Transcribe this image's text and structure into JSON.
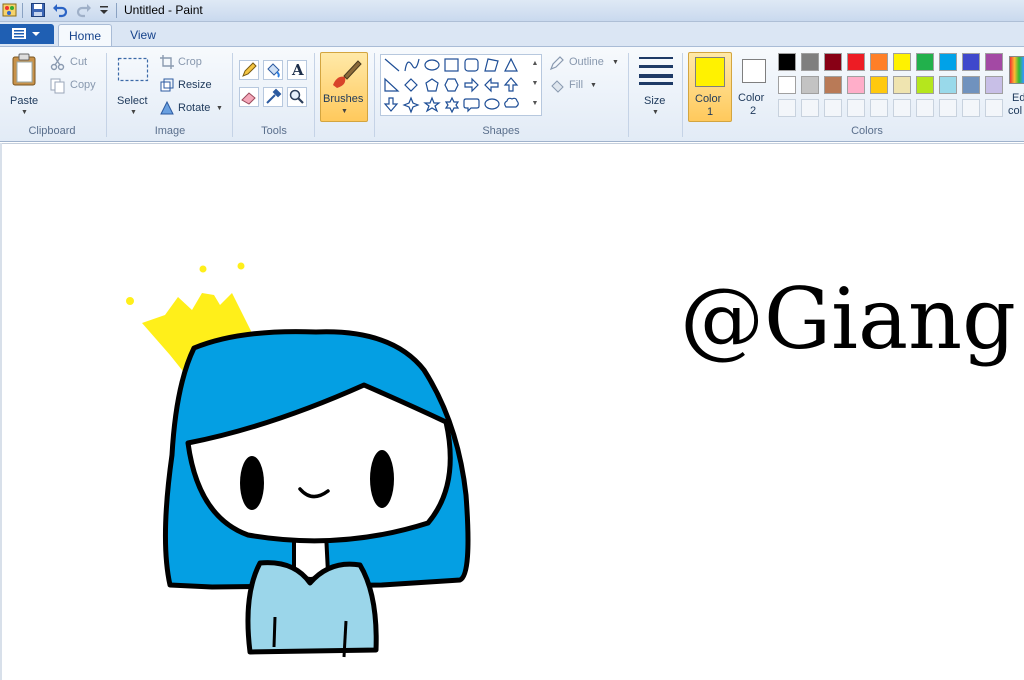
{
  "window": {
    "title": "Untitled - Paint"
  },
  "tabs": {
    "home": "Home",
    "view": "View"
  },
  "clipboard": {
    "paste": "Paste",
    "cut": "Cut",
    "copy": "Copy",
    "group": "Clipboard"
  },
  "image": {
    "select": "Select",
    "crop": "Crop",
    "resize": "Resize",
    "rotate": "Rotate",
    "group": "Image"
  },
  "tools": {
    "group": "Tools",
    "text_glyph": "A"
  },
  "brushes": {
    "label": "Brushes"
  },
  "shapes": {
    "group": "Shapes",
    "outline": "Outline",
    "fill": "Fill"
  },
  "size": {
    "label": "Size"
  },
  "colors": {
    "color1_label": "Color",
    "color1_num": "1",
    "color2_label": "Color",
    "color2_num": "2",
    "edit_label_1": "Ed",
    "edit_label_2": "col",
    "group": "Colors",
    "color1_value": "#fff200",
    "color2_value": "#ffffff",
    "palette_row1": [
      "#000000",
      "#7f7f7f",
      "#880015",
      "#ed1c24",
      "#ff7f27",
      "#fff200",
      "#22b14c",
      "#00a2e8",
      "#3f48cc",
      "#a349a4"
    ],
    "palette_row2": [
      "#ffffff",
      "#c3c3c3",
      "#b97a57",
      "#ffaec9",
      "#ffc90e",
      "#efe4b0",
      "#b5e61d",
      "#99d9ea",
      "#7092be",
      "#c8bfe7"
    ]
  },
  "canvas": {
    "handle_text": "@Giang"
  },
  "icons": {
    "paint_app": "paint-app-icon",
    "save": "save-icon",
    "undo": "undo-icon",
    "redo": "redo-icon",
    "customize": "customize-quick-access-icon",
    "file_menu": "file-menu-icon",
    "paste": "paste-icon",
    "cut": "scissors-icon",
    "copy": "copy-icon",
    "select": "select-rectangle-icon",
    "crop": "crop-icon",
    "resize": "resize-icon",
    "rotate": "rotate-icon",
    "pencil": "pencil-icon",
    "fill": "fill-bucket-icon",
    "text": "text-icon",
    "eraser": "eraser-icon",
    "picker": "color-picker-icon",
    "magnifier": "magnifier-icon",
    "brush": "brush-icon",
    "size": "line-size-icon"
  }
}
